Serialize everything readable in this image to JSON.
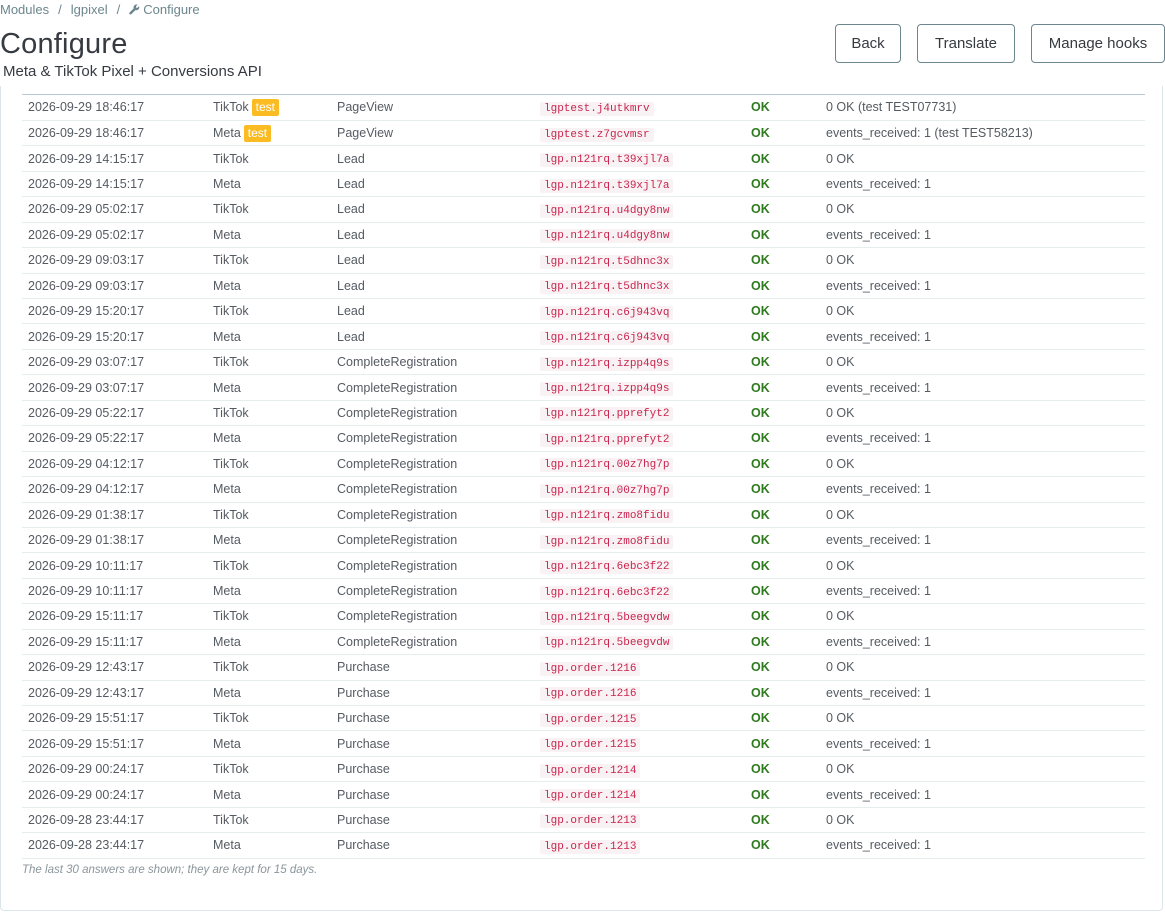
{
  "breadcrumb": {
    "modules": "Modules",
    "module": "lgpixel",
    "current": "Configure",
    "separator": "/"
  },
  "header": {
    "title": "Configure",
    "subtitle": "Meta & TikTok Pixel + Conversions API",
    "buttons": {
      "back": "Back",
      "translate": "Translate",
      "manage_hooks": "Manage hooks"
    }
  },
  "log": {
    "rows": [
      {
        "date": "2026-09-29 18:46:17",
        "channel": "TikTok",
        "badge": "test",
        "event": "PageView",
        "id": "lgptest.j4utkmrv",
        "status": "OK",
        "response": "0 OK (test TEST07731)"
      },
      {
        "date": "2026-09-29 18:46:17",
        "channel": "Meta",
        "badge": "test",
        "event": "PageView",
        "id": "lgptest.z7gcvmsr",
        "status": "OK",
        "response": "events_received: 1 (test TEST58213)"
      },
      {
        "date": "2026-09-29 14:15:17",
        "channel": "TikTok",
        "badge": "",
        "event": "Lead",
        "id": "lgp.n121rq.t39xjl7a",
        "status": "OK",
        "response": "0 OK"
      },
      {
        "date": "2026-09-29 14:15:17",
        "channel": "Meta",
        "badge": "",
        "event": "Lead",
        "id": "lgp.n121rq.t39xjl7a",
        "status": "OK",
        "response": "events_received: 1"
      },
      {
        "date": "2026-09-29 05:02:17",
        "channel": "TikTok",
        "badge": "",
        "event": "Lead",
        "id": "lgp.n121rq.u4dgy8nw",
        "status": "OK",
        "response": "0 OK"
      },
      {
        "date": "2026-09-29 05:02:17",
        "channel": "Meta",
        "badge": "",
        "event": "Lead",
        "id": "lgp.n121rq.u4dgy8nw",
        "status": "OK",
        "response": "events_received: 1"
      },
      {
        "date": "2026-09-29 09:03:17",
        "channel": "TikTok",
        "badge": "",
        "event": "Lead",
        "id": "lgp.n121rq.t5dhnc3x",
        "status": "OK",
        "response": "0 OK"
      },
      {
        "date": "2026-09-29 09:03:17",
        "channel": "Meta",
        "badge": "",
        "event": "Lead",
        "id": "lgp.n121rq.t5dhnc3x",
        "status": "OK",
        "response": "events_received: 1"
      },
      {
        "date": "2026-09-29 15:20:17",
        "channel": "TikTok",
        "badge": "",
        "event": "Lead",
        "id": "lgp.n121rq.c6j943vq",
        "status": "OK",
        "response": "0 OK"
      },
      {
        "date": "2026-09-29 15:20:17",
        "channel": "Meta",
        "badge": "",
        "event": "Lead",
        "id": "lgp.n121rq.c6j943vq",
        "status": "OK",
        "response": "events_received: 1"
      },
      {
        "date": "2026-09-29 03:07:17",
        "channel": "TikTok",
        "badge": "",
        "event": "CompleteRegistration",
        "id": "lgp.n121rq.izpp4q9s",
        "status": "OK",
        "response": "0 OK"
      },
      {
        "date": "2026-09-29 03:07:17",
        "channel": "Meta",
        "badge": "",
        "event": "CompleteRegistration",
        "id": "lgp.n121rq.izpp4q9s",
        "status": "OK",
        "response": "events_received: 1"
      },
      {
        "date": "2026-09-29 05:22:17",
        "channel": "TikTok",
        "badge": "",
        "event": "CompleteRegistration",
        "id": "lgp.n121rq.pprefyt2",
        "status": "OK",
        "response": "0 OK"
      },
      {
        "date": "2026-09-29 05:22:17",
        "channel": "Meta",
        "badge": "",
        "event": "CompleteRegistration",
        "id": "lgp.n121rq.pprefyt2",
        "status": "OK",
        "response": "events_received: 1"
      },
      {
        "date": "2026-09-29 04:12:17",
        "channel": "TikTok",
        "badge": "",
        "event": "CompleteRegistration",
        "id": "lgp.n121rq.00z7hg7p",
        "status": "OK",
        "response": "0 OK"
      },
      {
        "date": "2026-09-29 04:12:17",
        "channel": "Meta",
        "badge": "",
        "event": "CompleteRegistration",
        "id": "lgp.n121rq.00z7hg7p",
        "status": "OK",
        "response": "events_received: 1"
      },
      {
        "date": "2026-09-29 01:38:17",
        "channel": "TikTok",
        "badge": "",
        "event": "CompleteRegistration",
        "id": "lgp.n121rq.zmo8fidu",
        "status": "OK",
        "response": "0 OK"
      },
      {
        "date": "2026-09-29 01:38:17",
        "channel": "Meta",
        "badge": "",
        "event": "CompleteRegistration",
        "id": "lgp.n121rq.zmo8fidu",
        "status": "OK",
        "response": "events_received: 1"
      },
      {
        "date": "2026-09-29 10:11:17",
        "channel": "TikTok",
        "badge": "",
        "event": "CompleteRegistration",
        "id": "lgp.n121rq.6ebc3f22",
        "status": "OK",
        "response": "0 OK"
      },
      {
        "date": "2026-09-29 10:11:17",
        "channel": "Meta",
        "badge": "",
        "event": "CompleteRegistration",
        "id": "lgp.n121rq.6ebc3f22",
        "status": "OK",
        "response": "events_received: 1"
      },
      {
        "date": "2026-09-29 15:11:17",
        "channel": "TikTok",
        "badge": "",
        "event": "CompleteRegistration",
        "id": "lgp.n121rq.5beegvdw",
        "status": "OK",
        "response": "0 OK"
      },
      {
        "date": "2026-09-29 15:11:17",
        "channel": "Meta",
        "badge": "",
        "event": "CompleteRegistration",
        "id": "lgp.n121rq.5beegvdw",
        "status": "OK",
        "response": "events_received: 1"
      },
      {
        "date": "2026-09-29 12:43:17",
        "channel": "TikTok",
        "badge": "",
        "event": "Purchase",
        "id": "lgp.order.1216",
        "status": "OK",
        "response": "0 OK"
      },
      {
        "date": "2026-09-29 12:43:17",
        "channel": "Meta",
        "badge": "",
        "event": "Purchase",
        "id": "lgp.order.1216",
        "status": "OK",
        "response": "events_received: 1"
      },
      {
        "date": "2026-09-29 15:51:17",
        "channel": "TikTok",
        "badge": "",
        "event": "Purchase",
        "id": "lgp.order.1215",
        "status": "OK",
        "response": "0 OK"
      },
      {
        "date": "2026-09-29 15:51:17",
        "channel": "Meta",
        "badge": "",
        "event": "Purchase",
        "id": "lgp.order.1215",
        "status": "OK",
        "response": "events_received: 1"
      },
      {
        "date": "2026-09-29 00:24:17",
        "channel": "TikTok",
        "badge": "",
        "event": "Purchase",
        "id": "lgp.order.1214",
        "status": "OK",
        "response": "0 OK"
      },
      {
        "date": "2026-09-29 00:24:17",
        "channel": "Meta",
        "badge": "",
        "event": "Purchase",
        "id": "lgp.order.1214",
        "status": "OK",
        "response": "events_received: 1"
      },
      {
        "date": "2026-09-28 23:44:17",
        "channel": "TikTok",
        "badge": "",
        "event": "Purchase",
        "id": "lgp.order.1213",
        "status": "OK",
        "response": "0 OK"
      },
      {
        "date": "2026-09-28 23:44:17",
        "channel": "Meta",
        "badge": "",
        "event": "Purchase",
        "id": "lgp.order.1213",
        "status": "OK",
        "response": "events_received: 1"
      }
    ],
    "footnote": "The last 30 answers are shown; they are kept for 15 days."
  },
  "icons": {
    "breadcrumb_current": "wrench-icon"
  },
  "colors": {
    "ok": "#2f7a1e",
    "badge": "#fbbb22",
    "code": "#c7254e",
    "border": "#6c868e"
  }
}
